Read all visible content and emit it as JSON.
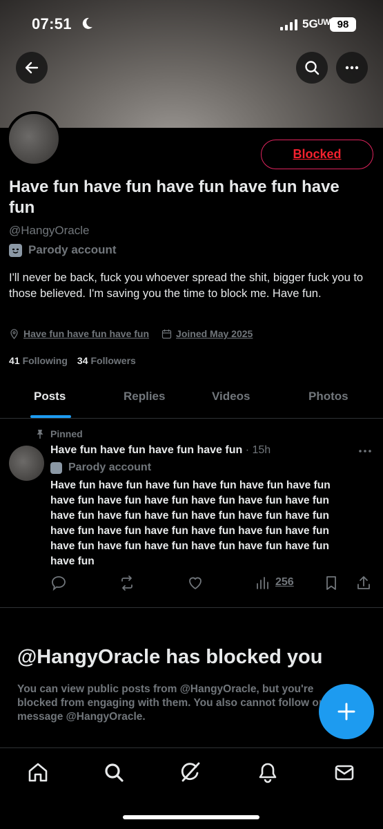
{
  "status_bar": {
    "time": "07:51",
    "network": "5Gᵁᵂ",
    "battery": "98"
  },
  "header": {
    "back_icon": "arrow-left-icon",
    "search_icon": "search-icon",
    "more_icon": "more-horizontal-icon"
  },
  "profile": {
    "display_name": "Have fun have fun have fun have fun have fun",
    "handle": "@HangyOracle",
    "parody_label": "Parody account",
    "bio": "I'll never be back, fuck you whoever spread the shit, bigger fuck you to those believed. I'm saving you the time to block me. Have fun.",
    "location": "Have fun have fun have fun",
    "joined": "Joined May 2025",
    "following_count": "41",
    "following_label": "Following",
    "followers_count": "34",
    "followers_label": "Followers",
    "blocked_button": "Blocked",
    "accent_color": "#1d9bf0",
    "blocked_color": "#f4212e"
  },
  "tabs": [
    {
      "label": "Posts",
      "active": true
    },
    {
      "label": "Replies",
      "active": false
    },
    {
      "label": "Videos",
      "active": false
    },
    {
      "label": "Photos",
      "active": false
    }
  ],
  "post": {
    "pinned_label": "Pinned",
    "author_name": "Have fun have fun have fun have fun",
    "time": "· 15h",
    "parody_label": "Parody account",
    "text_lines": [
      "Have fun have fun have fun have fun have fun have fun",
      "have fun have fun have fun have fun have fun have fun",
      "have fun have fun have fun have fun have fun have fun",
      "have fun have fun have fun have fun have fun have fun",
      "have fun have fun have fun have fun have fun have fun",
      "have fun"
    ],
    "views": "256"
  },
  "blocked_notice": {
    "title": "@HangyOracle has blocked you",
    "description": "You can view public posts from @HangyOracle, but you're blocked from engaging with them. You also cannot follow or message @HangyOracle."
  },
  "nav": [
    "home-icon",
    "search-icon",
    "grok-icon",
    "notifications-icon",
    "messages-icon"
  ]
}
